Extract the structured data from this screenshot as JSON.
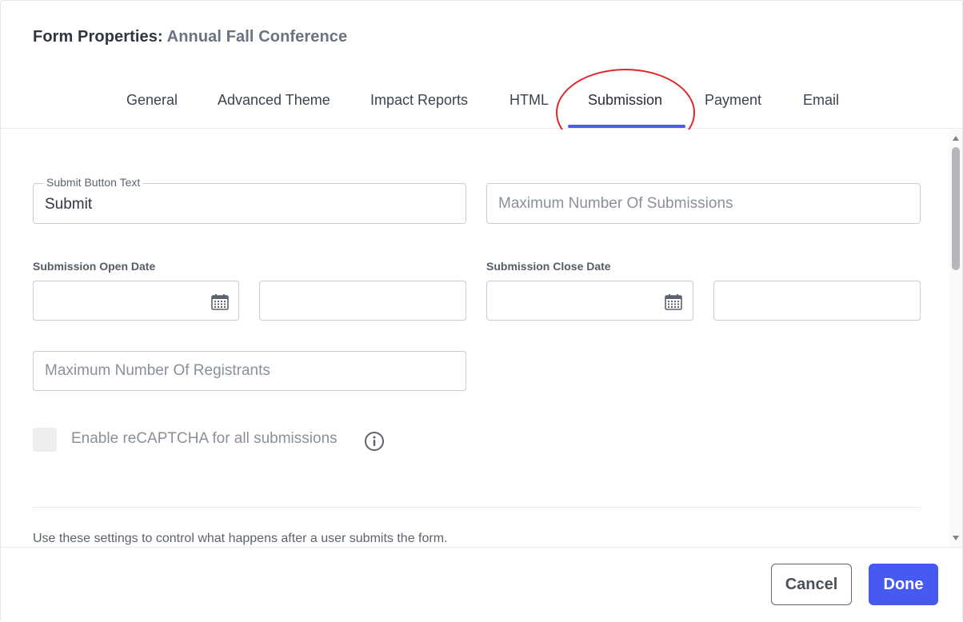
{
  "header": {
    "prefix": "Form Properties:",
    "form_name": "Annual Fall Conference"
  },
  "tabs": [
    {
      "label": "General",
      "active": false
    },
    {
      "label": "Advanced Theme",
      "active": false
    },
    {
      "label": "Impact Reports",
      "active": false
    },
    {
      "label": "HTML",
      "active": false
    },
    {
      "label": "Submission",
      "active": true
    },
    {
      "label": "Payment",
      "active": false
    },
    {
      "label": "Email",
      "active": false
    }
  ],
  "form": {
    "submit_button_text": {
      "label": "Submit Button Text",
      "value": "Submit"
    },
    "max_submissions": {
      "placeholder": "Maximum Number Of Submissions",
      "value": ""
    },
    "open_date_label": "Submission Open Date",
    "close_date_label": "Submission Close Date",
    "open_date": {
      "value": ""
    },
    "open_time": {
      "value": ""
    },
    "close_date": {
      "value": ""
    },
    "close_time": {
      "value": ""
    },
    "max_registrants": {
      "placeholder": "Maximum Number Of Registrants",
      "value": ""
    },
    "recaptcha": {
      "label": "Enable reCAPTCHA for all submissions",
      "checked": false
    },
    "help_text": "Use these settings to control what happens after a user submits the form."
  },
  "footer": {
    "cancel_label": "Cancel",
    "done_label": "Done"
  },
  "colors": {
    "accent": "#4659f0",
    "tab_underline": "#4a5ce8",
    "annotation_circle": "#e0262b"
  },
  "icons": {
    "open_date": "calendar-icon",
    "close_date": "calendar-icon",
    "recaptcha_info": "info-icon"
  }
}
